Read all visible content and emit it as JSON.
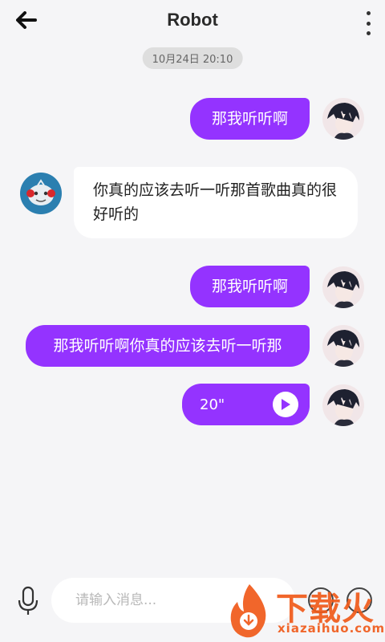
{
  "header": {
    "title": "Robot",
    "back_icon": "arrow-left-icon",
    "more_icon": "more-vertical-icon"
  },
  "timestamp": "10月24日 20:10",
  "messages": [
    {
      "side": "out",
      "text": "那我听听啊"
    },
    {
      "side": "in",
      "text": "你真的应该去听一听那首歌曲真的很好听的"
    },
    {
      "side": "out",
      "text": "那我听听啊"
    },
    {
      "side": "out",
      "text": "那我听听啊你真的应该去听一听那"
    },
    {
      "side": "out",
      "type": "voice",
      "duration": "20\""
    }
  ],
  "input": {
    "placeholder": "请输入消息...",
    "mic_icon": "microphone-icon"
  },
  "watermark": {
    "brand": "下载火",
    "domain": "xiazaihuo.com"
  },
  "colors": {
    "accent": "#9433ff",
    "background": "#f5f5f7",
    "watermark": "#f05a1a"
  }
}
